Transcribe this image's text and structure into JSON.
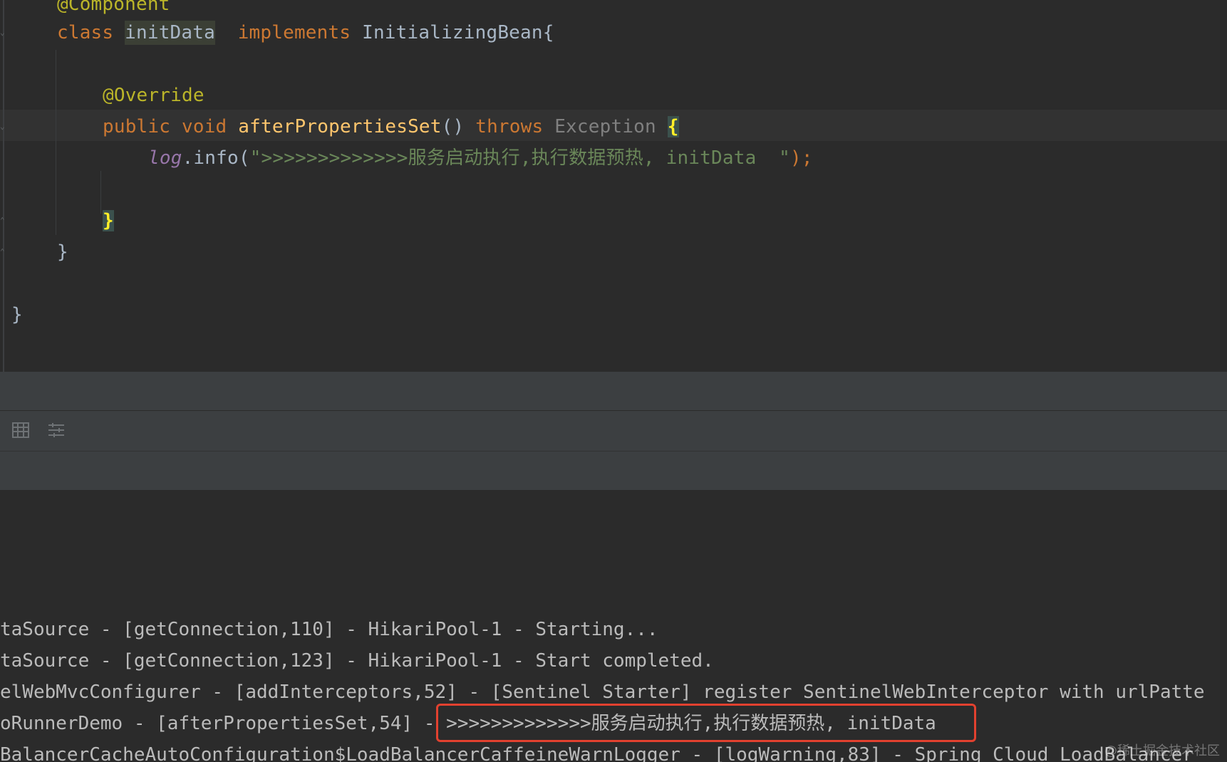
{
  "editor": {
    "lines": {
      "annotation_component": "@Component",
      "class_kw": "class",
      "class_name": "initData",
      "implements_kw": "implements",
      "interface_name": "InitializingBean{",
      "override": "@Override",
      "public_kw": "public",
      "void_kw": "void",
      "method_name": "afterPropertiesSet",
      "method_parens": "()",
      "throws_kw": "throws",
      "exception_type": "Exception",
      "open_brace": "{",
      "log_field": "log",
      "log_call": ".info(",
      "log_string": "\">>>>>>>>>>>>>服务启动执行,执行数据预热, initData  \"",
      "log_end": ");",
      "method_close": "}",
      "class_close": "}",
      "outer_close": "}"
    }
  },
  "toolbar": {
    "icons": [
      "table-icon",
      "settings-list-icon"
    ]
  },
  "console": {
    "lines": [
      "taSource - [getConnection,110] - HikariPool-1 - Starting...",
      "taSource - [getConnection,123] - HikariPool-1 - Start completed.",
      "elWebMvcConfigurer - [addInterceptors,52] - [Sentinel Starter] register SentinelWebInterceptor with urlPatte",
      "oRunnerDemo - [afterPropertiesSet,54] - >>>>>>>>>>>>>服务启动执行,执行数据预热, initData",
      "BalancerCacheAutoConfiguration$LoadBalancerCaffeineWarnLogger - [logWarning,83] - Spring Cloud LoadBalancer"
    ],
    "watermark": "@稀土掘金技术社区"
  },
  "colors": {
    "editor_bg": "#2b2b2b",
    "keyword": "#cc7832",
    "annotation": "#bbb529",
    "method": "#ffc66d",
    "string": "#6a8759",
    "highlight_border": "#e2412f"
  }
}
